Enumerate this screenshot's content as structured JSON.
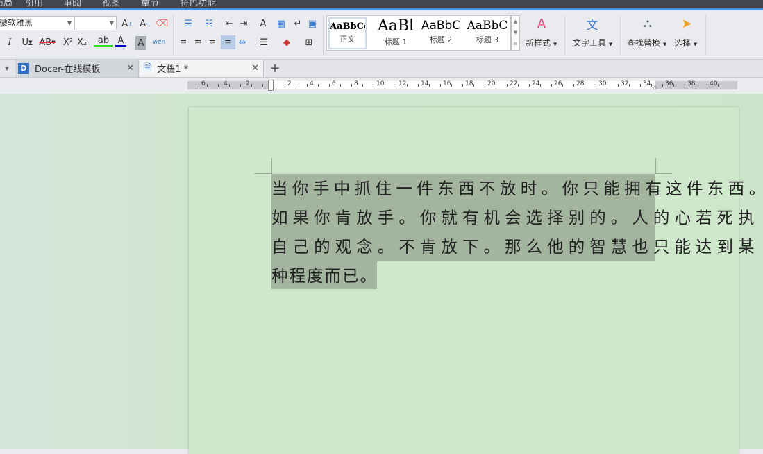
{
  "menu": [
    "布局",
    "引用",
    "审阅",
    "视图",
    "章节",
    "特色功能"
  ],
  "font": {
    "name": "微软雅黑",
    "size": ""
  },
  "styles": [
    {
      "preview": "AaBbCcI",
      "label": "正文"
    },
    {
      "preview": "AaBl",
      "label": "标题 1"
    },
    {
      "preview": "AaBbC",
      "label": "标题 2"
    },
    {
      "preview": "AaBbC",
      "label": "标题 3"
    }
  ],
  "buttons": {
    "new_style": "新样式",
    "text_tools": "文字工具",
    "find_replace": "查找替换",
    "select": "选择"
  },
  "tabs": [
    {
      "label": "Docer-在线模板"
    },
    {
      "label": "文档1 *"
    }
  ],
  "ruler": {
    "left": [
      "6",
      "4",
      "2"
    ],
    "right": [
      "2",
      "4",
      "6",
      "8",
      "10",
      "12",
      "14",
      "16",
      "18",
      "20",
      "22",
      "24",
      "26",
      "28",
      "30",
      "32",
      "34",
      "36",
      "38",
      "40"
    ]
  },
  "document": {
    "lines": [
      "当你手中抓住一件东西不放时。你只能拥有这件东西。",
      "如果你肯放手。你就有机会选择别的。人的心若死执",
      "自己的观念。不肯放下。那么他的智慧也只能达到某",
      "种程度而已。"
    ]
  }
}
